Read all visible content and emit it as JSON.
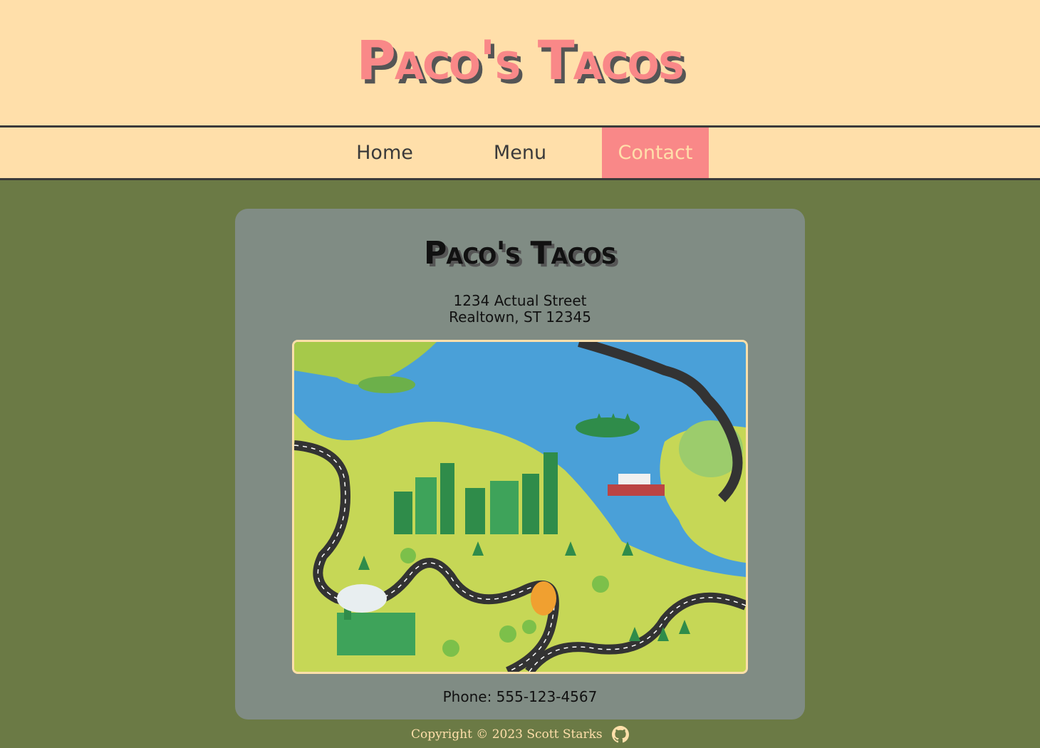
{
  "header": {
    "title": "Paco's Tacos"
  },
  "nav": {
    "items": [
      {
        "label": "Home"
      },
      {
        "label": "Menu"
      },
      {
        "label": "Contact",
        "active": true
      }
    ]
  },
  "contact": {
    "title": "Paco's Tacos",
    "address_line1": "1234 Actual Street",
    "address_line2": "Realtown, ST 12345",
    "phone": "Phone: 555-123-4567"
  },
  "footer": {
    "copyright": "Copyright © 2023 Scott Starks",
    "icon": "github-icon"
  },
  "colors": {
    "header_bg": "#ffdfaa",
    "accent": "#f98888",
    "page_bg": "#6b7a45",
    "card_bg": "#808c84",
    "text_dark": "#3a3a3a"
  }
}
